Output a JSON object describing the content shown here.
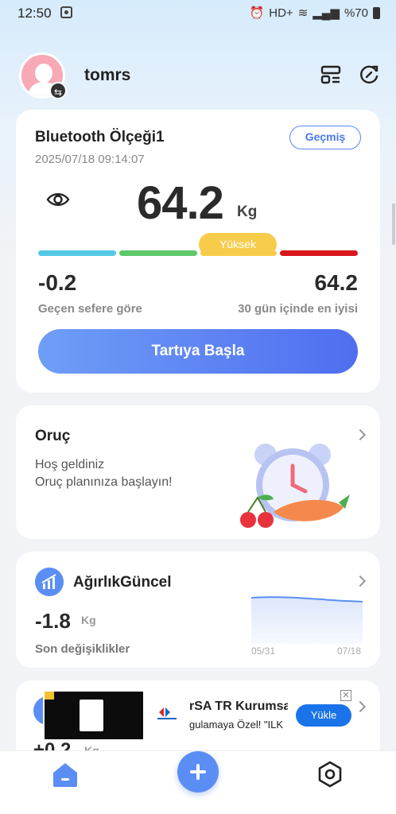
{
  "status_bar": {
    "time": "12:50",
    "network": "HD+",
    "battery": "%70"
  },
  "header": {
    "username": "tomrs"
  },
  "scale_card": {
    "title": "Bluetooth Ölçeği1",
    "date": "2025/07/18 09:14:07",
    "history_label": "Geçmiş",
    "weight": "64.2",
    "unit": "Kg",
    "level": "Yüksek",
    "level_colors": [
      "#55c8e6",
      "#5cc86a",
      "#f7cc4a",
      "#d9161c"
    ],
    "diff_value": "-0.2",
    "diff_label": "Geçen sefere göre",
    "best_value": "64.2",
    "best_label": "30 gün içinde en iyisi",
    "start_label": "Tartıya Başla"
  },
  "fasting_card": {
    "title": "Oruç",
    "line1": "Hoş geldiniz",
    "line2": "Oruç planınıza başlayın!"
  },
  "trend_card": {
    "title": "AğırlıkGüncel",
    "value": "-1.8",
    "unit": "Kg",
    "label": "Son değişiklikler",
    "axis_start": "05/31",
    "axis_end": "07/18"
  },
  "partial_card": {
    "value": "+0.2",
    "unit": "Kg"
  },
  "ad": {
    "line1": "rSA TR Kurumsal",
    "line2": "gulamaya Özel! \"ILK",
    "button": "Yükle",
    "close": "✕"
  },
  "accent_color": "#5b8ef5"
}
